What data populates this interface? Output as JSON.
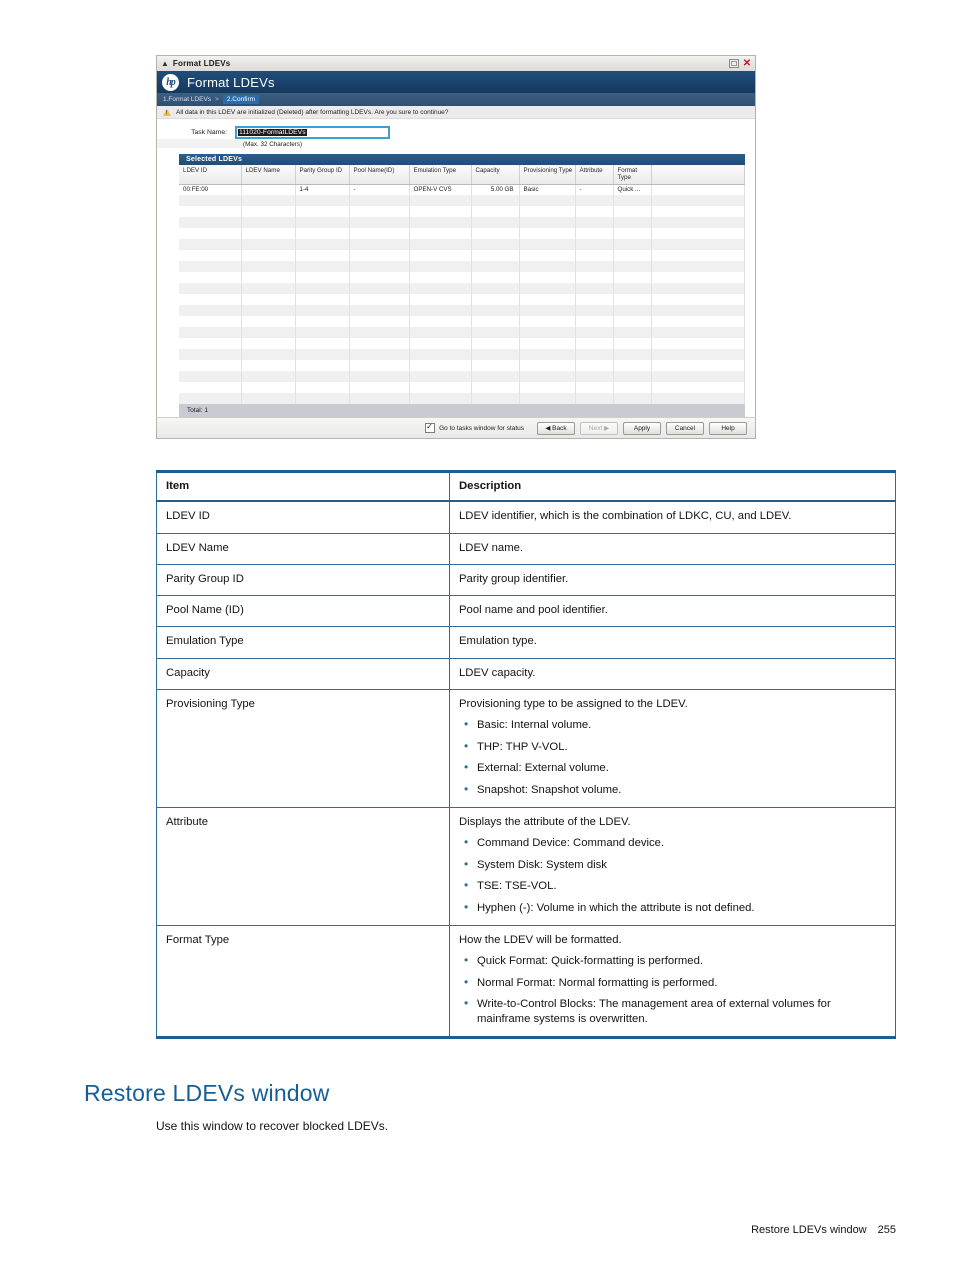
{
  "screenshot": {
    "window": {
      "title": "Format LDEVs",
      "maximize_label": "",
      "close_label": "✕"
    },
    "hp_header": {
      "logo_text": "hp",
      "title": "Format LDEVs"
    },
    "breadcrumb": {
      "step1": "1.Format LDEVs",
      "separator": ">",
      "step2": "2.Confirm"
    },
    "warning": "All data in this LDEV are initialized (Deleted) after formatting LDEVs. Are you sure to continue?",
    "task_name": {
      "label": "Task Name:",
      "value": "111020-FormatLDEVs",
      "hint": "(Max. 32 Characters)"
    },
    "grid": {
      "title": "Selected LDEVs",
      "columns": [
        "LDEV ID",
        "LDEV Name",
        "Parity Group ID",
        "Pool Name(ID)",
        "Emulation Type",
        "Capacity",
        "Provisioning Type",
        "Attribute",
        "Format Type",
        ""
      ],
      "rows": [
        {
          "ldev_id": "00:FE:00",
          "ldev_name": "",
          "parity_group_id": "1-4",
          "pool_name_id": "-",
          "emulation_type": "OPEN-V CVS",
          "capacity": "5.00 GB",
          "provisioning_type": "Basic",
          "attribute": "-",
          "format_type": "Quick ...",
          "spacer": ""
        }
      ],
      "total": "Total: 1"
    },
    "footer": {
      "checkbox_label": "Go to tasks window for status",
      "checkbox_checked": true,
      "buttons": [
        {
          "label": "◀ Back",
          "disabled": false
        },
        {
          "label": "Next ▶",
          "disabled": true
        },
        {
          "label": "Apply",
          "disabled": false
        },
        {
          "label": "Cancel",
          "disabled": false
        },
        {
          "label": "Help",
          "disabled": false
        }
      ]
    }
  },
  "doc_table": {
    "headers": {
      "item": "Item",
      "description": "Description"
    },
    "rows": [
      {
        "item": "LDEV ID",
        "description": "LDEV identifier, which is the combination of LDKC, CU, and LDEV.",
        "bullets": []
      },
      {
        "item": "LDEV Name",
        "description": "LDEV name.",
        "bullets": []
      },
      {
        "item": "Parity Group ID",
        "description": "Parity group identifier.",
        "bullets": []
      },
      {
        "item": "Pool Name (ID)",
        "description": "Pool name and pool identifier.",
        "bullets": []
      },
      {
        "item": "Emulation Type",
        "description": "Emulation type.",
        "bullets": []
      },
      {
        "item": "Capacity",
        "description": "LDEV capacity.",
        "bullets": []
      },
      {
        "item": "Provisioning Type",
        "description": "Provisioning type to be assigned to the LDEV.",
        "bullets": [
          "Basic: Internal volume.",
          "THP: THP V-VOL.",
          "External: External volume.",
          "Snapshot: Snapshot volume."
        ]
      },
      {
        "item": "Attribute",
        "description": "Displays the attribute of the LDEV.",
        "bullets": [
          "Command Device: Command device.",
          "System Disk: System disk",
          "TSE: TSE-VOL.",
          "Hyphen (-): Volume in which the attribute is not defined."
        ]
      },
      {
        "item": "Format Type",
        "description": "How the LDEV will be formatted.",
        "bullets": [
          "Quick Format: Quick-formatting is performed.",
          "Normal Format: Normal formatting is performed.",
          "Write-to-Control Blocks: The management area of external volumes for mainframe systems is overwritten."
        ]
      }
    ]
  },
  "section": {
    "heading": "Restore LDEVs window",
    "paragraph": "Use this window to recover blocked LDEVs."
  },
  "page_footer": {
    "title": "Restore LDEVs window",
    "page_number": "255"
  }
}
